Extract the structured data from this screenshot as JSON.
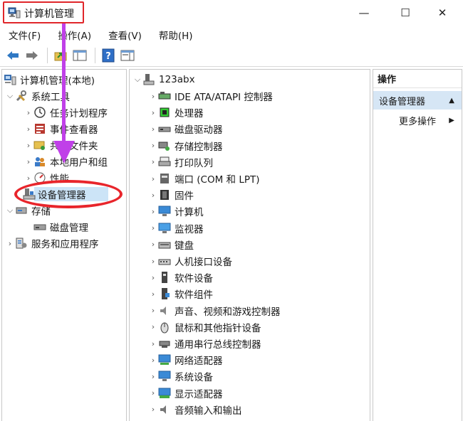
{
  "window": {
    "title": "计算机管理",
    "minimize_glyph": "—",
    "maximize_glyph": "☐",
    "close_glyph": "✕"
  },
  "menu": [
    "文件(F)",
    "操作(A)",
    "查看(V)",
    "帮助(H)"
  ],
  "toolbar": [
    "back-arrow-icon",
    "forward-arrow-icon",
    "up-folder-icon",
    "show-hide-tree-icon",
    "help-icon",
    "properties-icon"
  ],
  "left_tree": {
    "root": "计算机管理(本地)",
    "system_tools": "系统工具",
    "task_scheduler": "任务计划程序",
    "event_viewer": "事件查看器",
    "shared_folders": "共享文件夹",
    "local_users": "本地用户和组",
    "performance": "性能",
    "device_manager": "设备管理器",
    "storage": "存储",
    "disk_management": "磁盘管理",
    "services_apps": "服务和应用程序"
  },
  "device_tree": {
    "computer_name": "123abx",
    "categories": [
      "IDE ATA/ATAPI 控制器",
      "处理器",
      "磁盘驱动器",
      "存储控制器",
      "打印队列",
      "端口 (COM 和 LPT)",
      "固件",
      "计算机",
      "监视器",
      "键盘",
      "人机接口设备",
      "软件设备",
      "软件组件",
      "声音、视频和游戏控制器",
      "鼠标和其他指针设备",
      "通用串行总线控制器",
      "网络适配器",
      "系统设备",
      "显示适配器",
      "音频输入和输出"
    ]
  },
  "actions": {
    "header": "操作",
    "section": "设备管理器",
    "more": "更多操作"
  },
  "colors": {
    "annotation_red": "#e8252b",
    "annotation_arrow": "#c040e8",
    "selection": "#cce4f7",
    "actions_section": "#d6e6f5"
  }
}
